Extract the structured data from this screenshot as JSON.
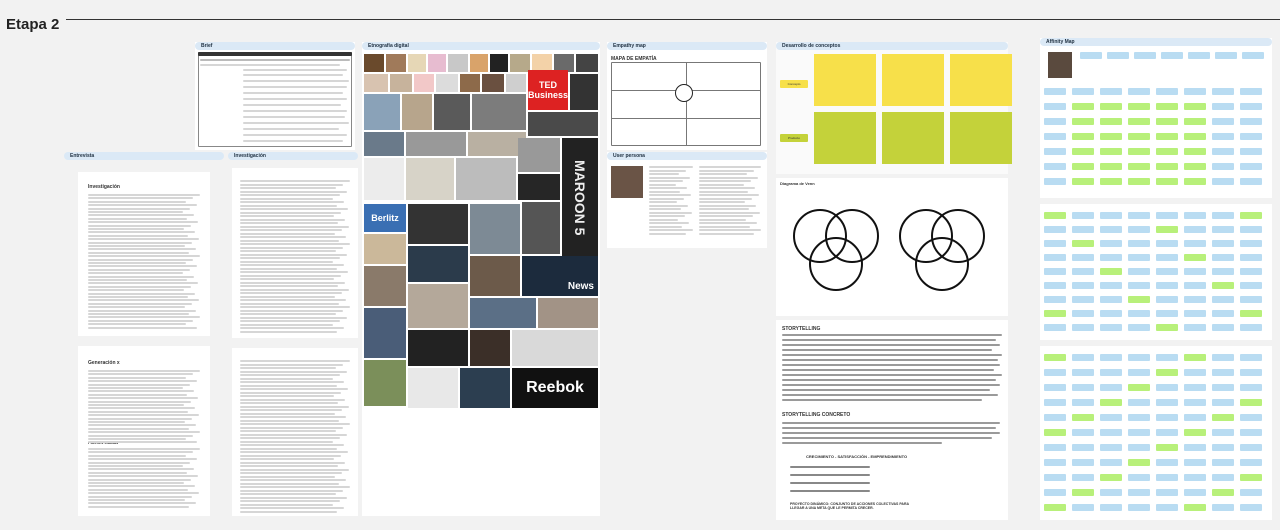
{
  "stage": {
    "title": "Etapa 2"
  },
  "boards": {
    "brief": "Brief",
    "etnografia": "Etnografía digital",
    "empathy": "Empathy map",
    "conceptos": "Desarrollo de conceptos",
    "affinity": "Affinity Map",
    "entrevista": "Entrevista",
    "investigacion": "Investigación",
    "persona": "User persona",
    "venn": "Diagrama de Venn"
  },
  "labels": {
    "mapa_empatia": "MAPA DE EMPATÍA",
    "storytelling": "STORYTELLING",
    "storytelling_concreto": "STORYTELLING CONCRETO",
    "crecimiento": "CRECIMIENTO - SATISFACCIÓN - EMPRENDIMIENTO",
    "proyecto": "PROYECTO DINÁMICO: CONJUNTO DE ACCIONES COLECTIVAS PARA LLEGAR A UNA META QUE LE PERMITA CRECER.",
    "investigacion_title": "Investigación",
    "generacion_x": "Generación x",
    "fuentes": "Fuentes citadas",
    "ted": "TED Business",
    "berlitz": "Berlitz",
    "news": "News",
    "reebok": "Reebok",
    "maroon": "MAROON 5",
    "concepto_1": "Concepto",
    "concepto_2": "Producto"
  },
  "colors": {
    "header": "#dbe9f6",
    "sticky_yellow": "#f7e04a",
    "sticky_olive": "#c4d23a",
    "affinity_blue": "#b9dcf2",
    "affinity_green": "#b8f07a"
  }
}
